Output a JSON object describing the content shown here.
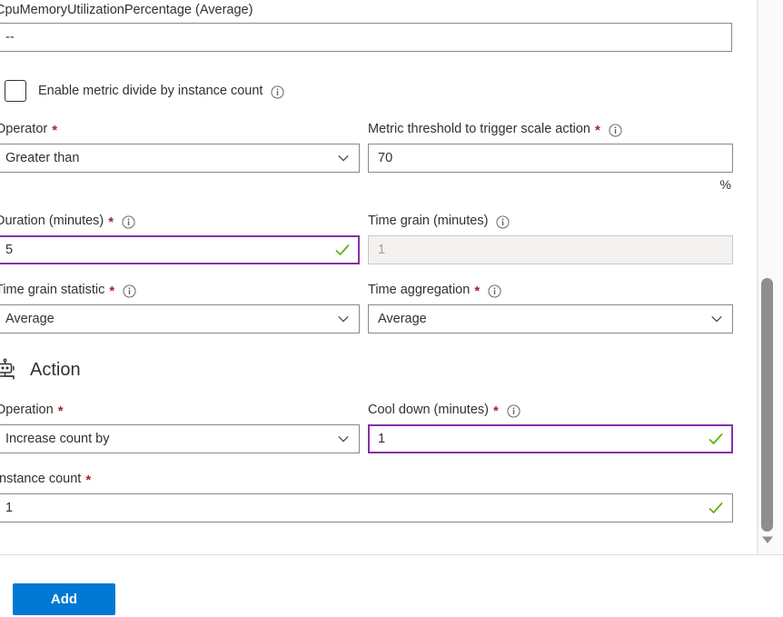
{
  "metric": {
    "label": "CpuMemoryUtilizationPercentage (Average)",
    "value": "--"
  },
  "divide_by_instance": {
    "label": "Enable metric divide by instance count",
    "checked": false,
    "info_icon": "info-icon"
  },
  "operator": {
    "label": "Operator",
    "required": "*",
    "value": "Greater than",
    "chevron_icon": "chevron-down-icon"
  },
  "threshold": {
    "label": "Metric threshold to trigger scale action",
    "required": "*",
    "info_icon": "info-icon",
    "value": "70",
    "suffix": "%"
  },
  "duration": {
    "label": "Duration (minutes)",
    "required": "*",
    "info_icon": "info-icon",
    "value": "5",
    "state": "focused-valid",
    "check_icon": "checkmark-icon"
  },
  "time_grain": {
    "label": "Time grain (minutes)",
    "value": "1",
    "info_icon": "info-icon",
    "state": "disabled"
  },
  "time_grain_statistic": {
    "label": "Time grain statistic",
    "required": "*",
    "info_icon": "info-icon",
    "value": "Average",
    "chevron_icon": "chevron-down-icon"
  },
  "time_aggregation": {
    "label": "Time aggregation",
    "required": "*",
    "info_icon": "info-icon",
    "value": "Average",
    "chevron_icon": "chevron-down-icon"
  },
  "action_section": {
    "title": "Action",
    "icon": "robot-icon"
  },
  "operation": {
    "label": "Operation",
    "required": "*",
    "value": "Increase count by",
    "chevron_icon": "chevron-down-icon"
  },
  "cool_down": {
    "label": "Cool down (minutes)",
    "required": "*",
    "info_icon": "info-icon",
    "value": "1",
    "state": "focused-valid",
    "check_icon": "checkmark-icon"
  },
  "instance_count": {
    "label": "Instance count",
    "required": "*",
    "value": "1",
    "check_icon": "checkmark-icon"
  },
  "footer": {
    "add_label": "Add"
  },
  "scrollbar": {
    "down_arrow_icon": "scroll-down-arrow-icon"
  },
  "colors": {
    "accent": "#0078d4",
    "required_asterisk": "#a4262c",
    "focus_border": "#8332a8",
    "valid_check": "#5cb500",
    "field_border": "#8a8886",
    "disabled_bg": "#f3f2f1"
  }
}
